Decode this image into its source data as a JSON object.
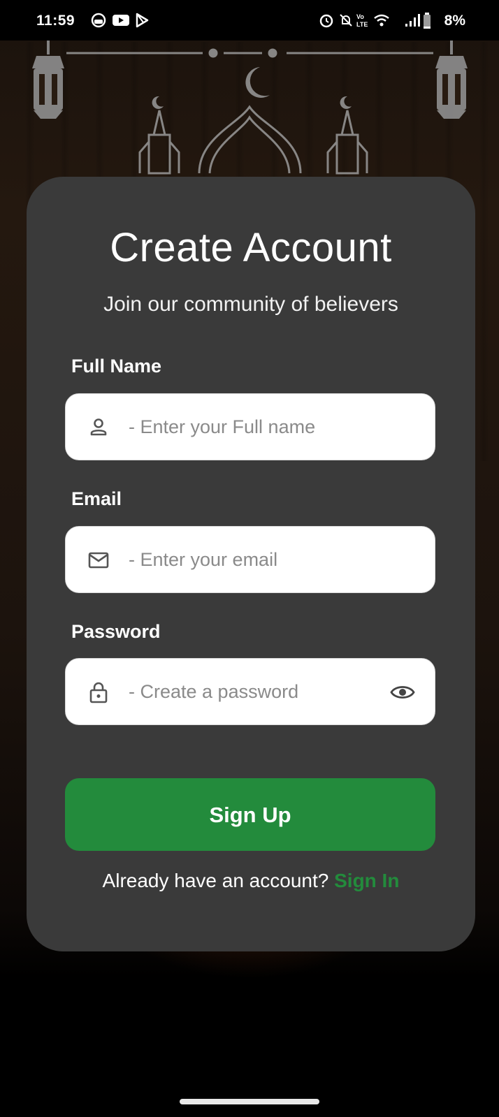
{
  "status_bar": {
    "time": "11:59",
    "battery": "8%",
    "left_icons": [
      "headset-status-icon",
      "youtube-icon",
      "play-store-icon"
    ],
    "right_icons": [
      "alarm-icon",
      "notifications-off-icon",
      "volte-icon",
      "wifi-icon",
      "signal-icon",
      "battery-icon"
    ]
  },
  "form": {
    "title": "Create Account",
    "subtitle": "Join our community of believers",
    "full_name": {
      "label": "Full Name",
      "placeholder": "- Enter your Full name",
      "value": "",
      "icon": "person-icon"
    },
    "email": {
      "label": "Email",
      "placeholder": "- Enter your email",
      "value": "",
      "icon": "mail-icon"
    },
    "password": {
      "label": "Password",
      "placeholder": "- Create a password",
      "value": "",
      "icon": "lock-icon",
      "toggle_icon": "eye-icon"
    },
    "submit_label": "Sign Up",
    "signin_prompt": "Already have an account?",
    "signin_link": "Sign In"
  },
  "colors": {
    "card": "#3a3a3a",
    "accent": "#238b3c",
    "field_bg": "#ffffff",
    "placeholder": "#8a8a8a"
  }
}
